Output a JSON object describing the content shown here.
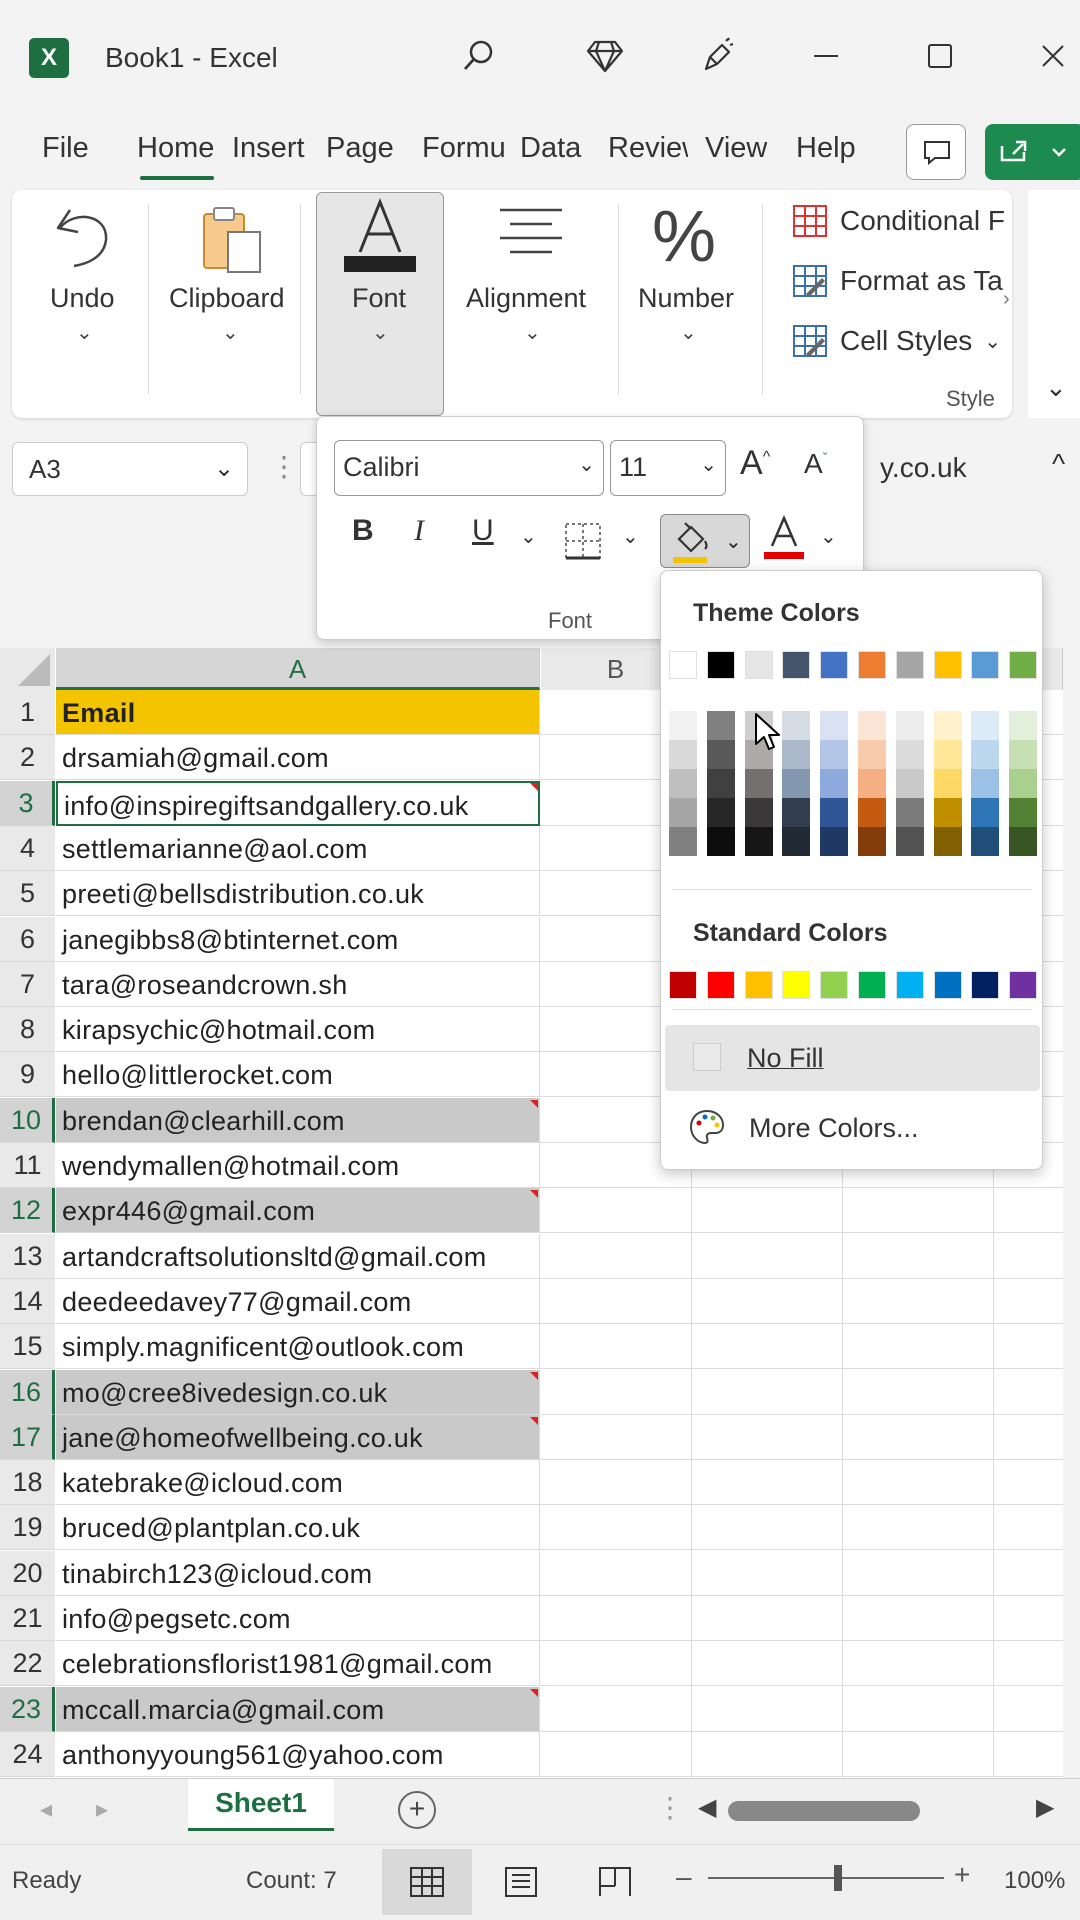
{
  "window": {
    "app_icon_letter": "X",
    "title": "Book1  -  Excel"
  },
  "tabs": [
    "File",
    "Home",
    "Insert",
    "Page",
    "Formulas",
    "Data",
    "Review",
    "View",
    "Help"
  ],
  "ribbon": {
    "undo_label": "Undo",
    "clipboard_label": "Clipboard",
    "font_label": "Font",
    "alignment_label": "Alignment",
    "number_label": "Number",
    "number_glyph": "%",
    "styles_items": [
      "Conditional F",
      "Format as Ta",
      "Cell Styles"
    ],
    "styles_label": "Style"
  },
  "namebox": {
    "value": "A3"
  },
  "formula": {
    "value_visible": "y.co.uk"
  },
  "font_panel": {
    "font_name": "Calibri",
    "font_size": "11",
    "bold": "B",
    "italic": "I",
    "underline": "U",
    "group_label": "Font",
    "fill_color": "#f5c400",
    "font_color": "#e00000"
  },
  "columns": [
    "A",
    "B"
  ],
  "rows": [
    {
      "n": "1",
      "value": "Email",
      "header": true
    },
    {
      "n": "2",
      "value": "drsamiah@gmail.com"
    },
    {
      "n": "3",
      "value": "info@inspiregiftsandgallery.co.uk",
      "active": true
    },
    {
      "n": "4",
      "value": "settlemarianne@aol.com"
    },
    {
      "n": "5",
      "value": "preeti@bellsdistribution.co.uk"
    },
    {
      "n": "6",
      "value": "janegibbs8@btinternet.com"
    },
    {
      "n": "7",
      "value": "tara@roseandcrown.sh"
    },
    {
      "n": "8",
      "value": "kirapsychic@hotmail.com"
    },
    {
      "n": "9",
      "value": "hello@littlerocket.com"
    },
    {
      "n": "10",
      "value": "brendan@clearhill.com",
      "selected": true
    },
    {
      "n": "11",
      "value": "wendymallen@hotmail.com"
    },
    {
      "n": "12",
      "value": "expr446@gmail.com",
      "selected": true
    },
    {
      "n": "13",
      "value": "artandcraftsolutionsltd@gmail.com"
    },
    {
      "n": "14",
      "value": "deedeedavey77@gmail.com"
    },
    {
      "n": "15",
      "value": "simply.magnificent@outlook.com"
    },
    {
      "n": "16",
      "value": "mo@cree8ivedesign.co.uk",
      "selected": true
    },
    {
      "n": "17",
      "value": "jane@homeofwellbeing.co.uk",
      "selected": true
    },
    {
      "n": "18",
      "value": "katebrake@icloud.com"
    },
    {
      "n": "19",
      "value": "bruced@plantplan.co.uk"
    },
    {
      "n": "20",
      "value": "tinabirch123@icloud.com"
    },
    {
      "n": "21",
      "value": "info@pegsetc.com"
    },
    {
      "n": "22",
      "value": "celebrationsflorist1981@gmail.com"
    },
    {
      "n": "23",
      "value": "mccall.marcia@gmail.com",
      "selected": true
    },
    {
      "n": "24",
      "value": "anthonyyoung561@yahoo.com"
    }
  ],
  "color_menu": {
    "theme_heading": "Theme Colors",
    "theme_colors": [
      "#ffffff",
      "#000000",
      "#e7e6e6",
      "#44546a",
      "#4472c4",
      "#ed7d31",
      "#a5a5a5",
      "#ffc000",
      "#5b9bd5",
      "#70ad47"
    ],
    "theme_shades": [
      [
        "#f2f2f2",
        "#d9d9d9",
        "#bfbfbf",
        "#a6a6a6",
        "#808080"
      ],
      [
        "#808080",
        "#595959",
        "#404040",
        "#262626",
        "#0d0d0d"
      ],
      [
        "#d0cece",
        "#aeaaaa",
        "#757070",
        "#3a3838",
        "#171616"
      ],
      [
        "#d6dce4",
        "#acb9ca",
        "#8497b0",
        "#333f4f",
        "#222a35"
      ],
      [
        "#d9e1f2",
        "#b4c6e7",
        "#8ea9db",
        "#2f5597",
        "#1f3864"
      ],
      [
        "#fbe5d6",
        "#f8cbad",
        "#f4b084",
        "#c55a11",
        "#833c0b"
      ],
      [
        "#ededed",
        "#dbdbdb",
        "#c9c9c9",
        "#7b7b7b",
        "#525252"
      ],
      [
        "#fff2cc",
        "#ffe699",
        "#ffd966",
        "#bf8f00",
        "#806000"
      ],
      [
        "#ddebf7",
        "#bdd7ee",
        "#9bc2e6",
        "#2e75b6",
        "#1f4e79"
      ],
      [
        "#e2efda",
        "#c6e0b4",
        "#a9d08e",
        "#548235",
        "#375623"
      ]
    ],
    "standard_heading": "Standard Colors",
    "standard_colors": [
      "#c00000",
      "#ff0000",
      "#ffc000",
      "#ffff00",
      "#92d050",
      "#00b050",
      "#00b0f0",
      "#0070c0",
      "#002060",
      "#7030a0"
    ],
    "no_fill_label": "No Fill",
    "more_colors_label": "More Colors..."
  },
  "sheet": {
    "tab_label": "Sheet1",
    "add_label": "+"
  },
  "status": {
    "ready": "Ready",
    "count": "Count: 7",
    "zoom": "100%",
    "zoom_level": 0.55
  }
}
